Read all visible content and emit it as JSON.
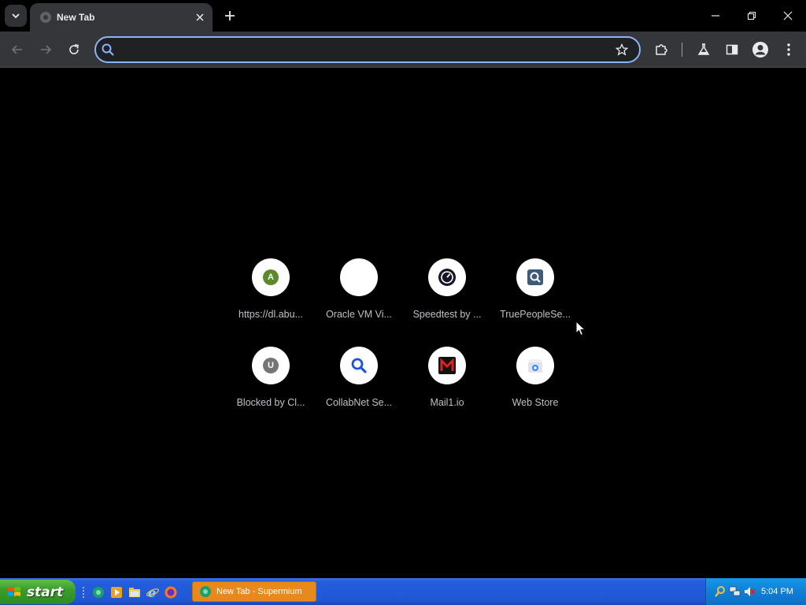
{
  "browser": {
    "tab_title": "New Tab",
    "omnibox_placeholder": "",
    "accent_color": "#8ab4f8"
  },
  "shortcuts": [
    {
      "label": "https://dl.abu...",
      "icon": "letter-a-icon",
      "letter": "A",
      "color": "#5a8a2a"
    },
    {
      "label": "Oracle VM Vi...",
      "icon": "blank-icon",
      "letter": "",
      "color": "#ffffff"
    },
    {
      "label": "Speedtest by ...",
      "icon": "speedometer-icon",
      "letter": "",
      "color": "#141526"
    },
    {
      "label": "TruePeopleSe...",
      "icon": "magnifier-icon",
      "letter": "",
      "color": "#3d5a7a"
    },
    {
      "label": "Blocked by Cl...",
      "icon": "letter-u-icon",
      "letter": "U",
      "color": "#757575"
    },
    {
      "label": "CollabNet Se...",
      "icon": "search-icon",
      "letter": "",
      "color": "#1a56db"
    },
    {
      "label": "Mail1.io",
      "icon": "mail1-logo-icon",
      "letter": "",
      "color": "#e02020"
    },
    {
      "label": "Web Store",
      "icon": "web-store-icon",
      "letter": "",
      "color": "#4285f4"
    }
  ],
  "taskbar": {
    "start_label": "start",
    "task_item_label": "New Tab - Supermium",
    "clock": "5:04 PM"
  }
}
